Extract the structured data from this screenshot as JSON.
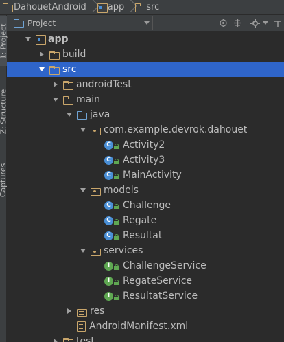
{
  "breadcrumb": {
    "items": [
      {
        "label": "DahouetAndroid"
      },
      {
        "label": "app"
      },
      {
        "label": "src"
      }
    ]
  },
  "left_tabs": [
    {
      "label": "1: Project"
    },
    {
      "label": "Z: Structure"
    },
    {
      "label": "Captures"
    }
  ],
  "panel": {
    "view_label": "Project",
    "buttons": [
      "target-icon",
      "collapse-icon",
      "gear-icon",
      "hide-icon"
    ]
  },
  "tree": [
    {
      "label": "app",
      "depth": 0,
      "icon": "module-icon",
      "expanded": true,
      "bold": true
    },
    {
      "label": "build",
      "depth": 1,
      "icon": "folder-icon",
      "expanded": false
    },
    {
      "label": "src",
      "depth": 1,
      "icon": "folder-icon",
      "expanded": true,
      "selected": true
    },
    {
      "label": "androidTest",
      "depth": 2,
      "icon": "folder-icon",
      "expanded": false
    },
    {
      "label": "main",
      "depth": 2,
      "icon": "folder-icon",
      "expanded": true
    },
    {
      "label": "java",
      "depth": 3,
      "icon": "source-folder-icon",
      "expanded": true
    },
    {
      "label": "com.example.devrok.dahouet",
      "depth": 4,
      "icon": "package-icon",
      "expanded": true
    },
    {
      "label": "Activity2",
      "depth": 5,
      "icon": "class-icon"
    },
    {
      "label": "Activity3",
      "depth": 5,
      "icon": "class-icon"
    },
    {
      "label": "MainActivity",
      "depth": 5,
      "icon": "class-icon"
    },
    {
      "label": "models",
      "depth": 4,
      "icon": "package-icon",
      "expanded": true
    },
    {
      "label": "Challenge",
      "depth": 5,
      "icon": "class-icon"
    },
    {
      "label": "Regate",
      "depth": 5,
      "icon": "class-icon"
    },
    {
      "label": "Resultat",
      "depth": 5,
      "icon": "class-icon"
    },
    {
      "label": "services",
      "depth": 4,
      "icon": "package-icon",
      "expanded": true
    },
    {
      "label": "ChallengeService",
      "depth": 5,
      "icon": "interface-icon"
    },
    {
      "label": "RegateService",
      "depth": 5,
      "icon": "interface-icon"
    },
    {
      "label": "ResultatService",
      "depth": 5,
      "icon": "interface-icon"
    },
    {
      "label": "res",
      "depth": 3,
      "icon": "resources-folder-icon",
      "expanded": false
    },
    {
      "label": "AndroidManifest.xml",
      "depth": 3,
      "icon": "manifest-icon"
    },
    {
      "label": "test",
      "depth": 2,
      "icon": "folder-icon",
      "expanded": false
    }
  ],
  "colors": {
    "background": "#2b2b2b",
    "selection": "#2f65ca",
    "folder": "#c9a66b",
    "class": "#4a8fd6",
    "interface": "#5fa752"
  }
}
